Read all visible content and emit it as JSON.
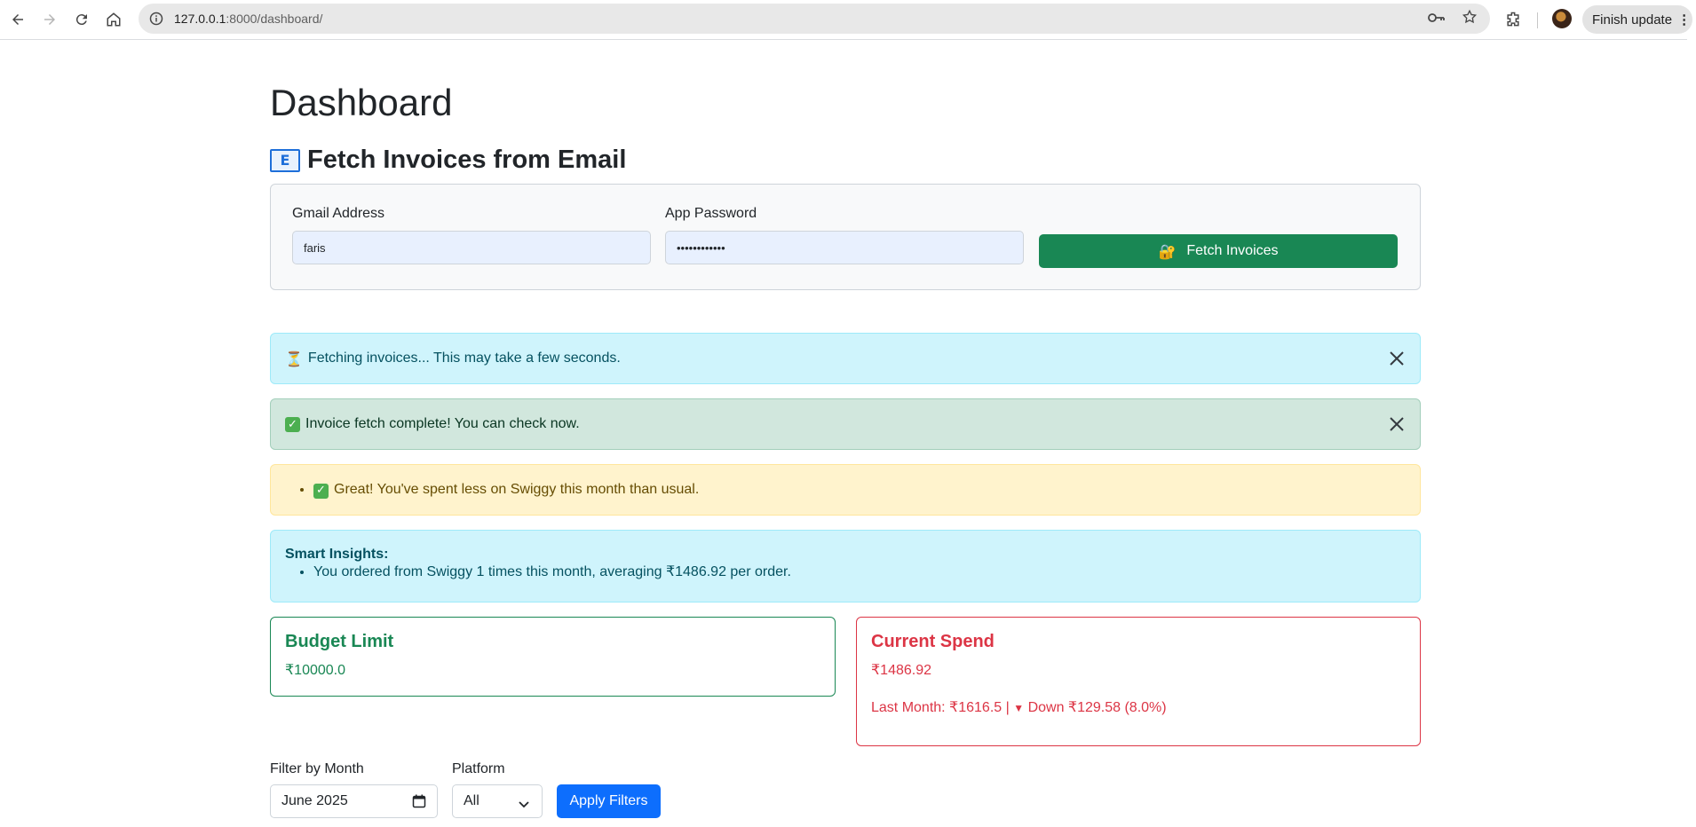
{
  "browser": {
    "url_host": "127.0.0.1",
    "url_rest": ":8000/dashboard/",
    "finish_update_label": "Finish update"
  },
  "page": {
    "title": "Dashboard",
    "fetch_section": {
      "title": "Fetch Invoices from Email",
      "email_label": "Gmail Address",
      "email_value": "faris",
      "password_label": "App Password",
      "password_value": "••••••••••••",
      "fetch_button_label": "Fetch Invoices",
      "fetch_button_emoji": "🔐"
    },
    "alerts": {
      "fetching": "Fetching invoices... This may take a few seconds.",
      "fetching_emoji": "⏳",
      "complete": "Invoice fetch complete! You can check now.",
      "tip": "Great! You've spent less on Swiggy this month than usual.",
      "insights_title": "Smart Insights:",
      "insights": [
        "You ordered from Swiggy 1 times this month, averaging ₹1486.92 per order."
      ]
    },
    "budget": {
      "title": "Budget Limit",
      "value": "₹10000.0"
    },
    "spend": {
      "title": "Current Spend",
      "value": "₹1486.92",
      "last_month_text": "Last Month: ₹1616.5 |",
      "change_text": "Down ₹129.58 (8.0%)"
    },
    "filters": {
      "month_label": "Filter by Month",
      "month_value": "June 2025",
      "platform_label": "Platform",
      "platform_value": "All",
      "apply_label": "Apply Filters"
    }
  },
  "colors": {
    "success": "#198754",
    "danger": "#dc3545",
    "primary": "#0d6efd"
  }
}
